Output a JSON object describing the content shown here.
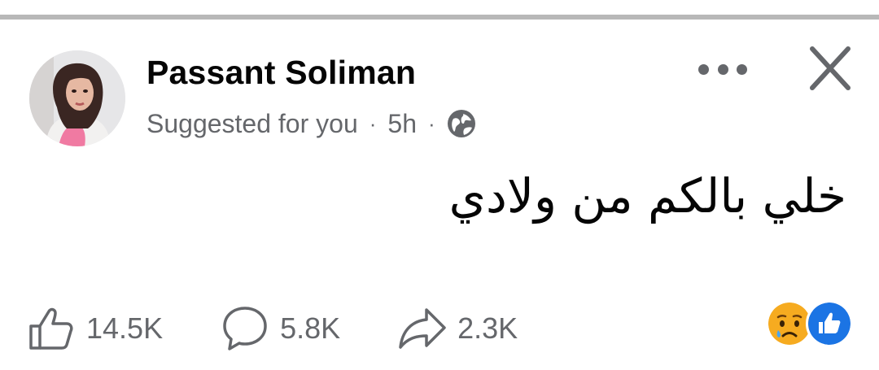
{
  "post": {
    "author": "Passant Soliman",
    "context": "Suggested for you",
    "time": "5h",
    "separator": "·",
    "audience_icon": "globe-icon",
    "text": "خلي بالكم من ولادي"
  },
  "header_actions": {
    "more_icon": "more-horizontal-icon",
    "close_icon": "close-icon"
  },
  "engagement": {
    "likes": "14.5K",
    "comments": "5.8K",
    "shares": "2.3K",
    "reaction_icons": [
      "sad-reaction-icon",
      "like-reaction-icon"
    ]
  },
  "colors": {
    "text_primary": "#050505",
    "text_secondary": "#65676b",
    "like_blue": "#1b74e4",
    "sad_yellow": "#f7b125",
    "divider": "#b8b8b8"
  }
}
